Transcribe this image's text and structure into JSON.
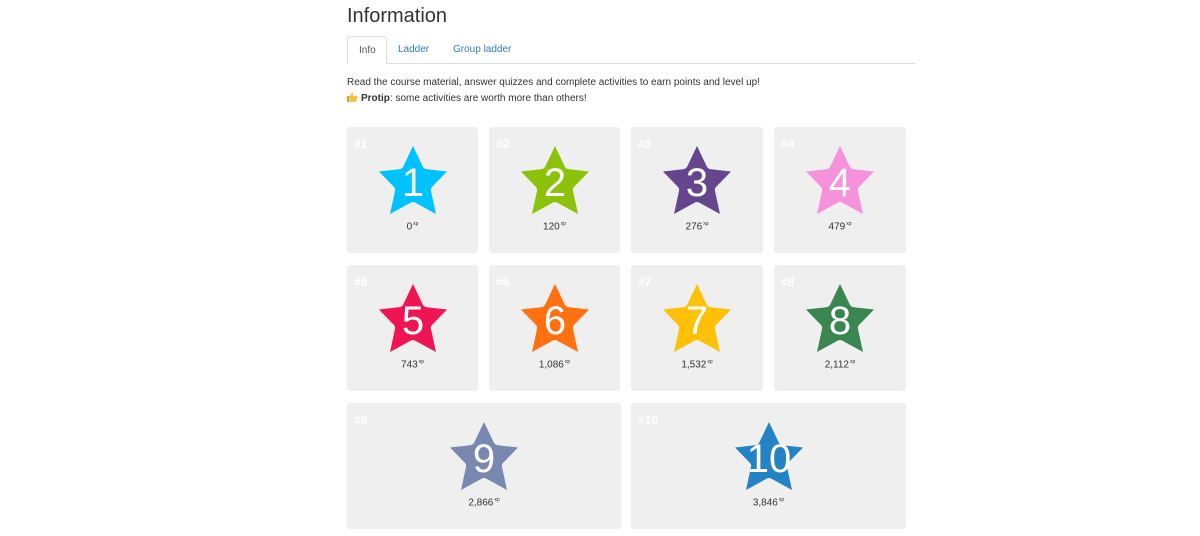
{
  "page": {
    "title": "Information"
  },
  "tabs": [
    {
      "label": "Info",
      "active": true
    },
    {
      "label": "Ladder",
      "active": false
    },
    {
      "label": "Group ladder",
      "active": false
    }
  ],
  "intro": {
    "line1": "Read the course material, answer quizzes and complete activities to earn points and level up!",
    "protip_icon": "thumbs-up-icon",
    "protip_label": "Protip",
    "protip_text": ": some activities are worth more than others!"
  },
  "xp_unit": "xp",
  "levels": [
    {
      "rank": "#1",
      "number": "1",
      "xp": "0",
      "color": "#00c2ff"
    },
    {
      "rank": "#2",
      "number": "2",
      "xp": "120",
      "color": "#8cc20a"
    },
    {
      "rank": "#3",
      "number": "3",
      "xp": "276",
      "color": "#66458f"
    },
    {
      "rank": "#4",
      "number": "4",
      "xp": "479",
      "color": "#f592db"
    },
    {
      "rank": "#5",
      "number": "5",
      "xp": "743",
      "color": "#ee1552"
    },
    {
      "rank": "#6",
      "number": "6",
      "xp": "1,086",
      "color": "#ff7010"
    },
    {
      "rank": "#7",
      "number": "7",
      "xp": "1,532",
      "color": "#ffc107"
    },
    {
      "rank": "#8",
      "number": "8",
      "xp": "2,112",
      "color": "#3a8650"
    },
    {
      "rank": "#9",
      "number": "9",
      "xp": "2,866",
      "color": "#7988b0"
    },
    {
      "rank": "#10",
      "number": "10",
      "xp": "3,846",
      "color": "#2582c4"
    }
  ]
}
